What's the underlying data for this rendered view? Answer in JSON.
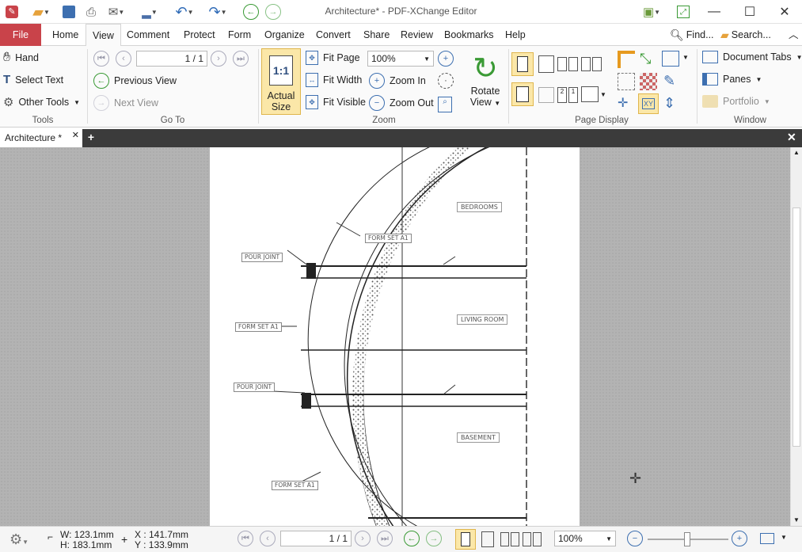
{
  "window": {
    "title": "Architecture* - PDF-XChange Editor"
  },
  "menu": {
    "file": "File",
    "home": "Home",
    "view": "View",
    "comment": "Comment",
    "protect": "Protect",
    "form": "Form",
    "organize": "Organize",
    "convert": "Convert",
    "share": "Share",
    "review": "Review",
    "bookmarks": "Bookmarks",
    "help": "Help",
    "find": "Find...",
    "search": "Search..."
  },
  "tools": {
    "hand": "Hand",
    "select_text": "Select Text",
    "other_tools": "Other Tools",
    "group": "Tools"
  },
  "goto": {
    "page_value": "1 / 1",
    "previous_view": "Previous View",
    "next_view": "Next View",
    "group": "Go To"
  },
  "zoom": {
    "actual_size_1": "Actual",
    "actual_size_2": "Size",
    "actual_icon": "1:1",
    "fit_page": "Fit Page",
    "fit_width": "Fit Width",
    "fit_visible": "Fit Visible",
    "zoom_value": "100%",
    "zoom_in": "Zoom In",
    "zoom_out": "Zoom Out",
    "rotate_1": "Rotate",
    "rotate_2": "View",
    "group": "Zoom"
  },
  "page_display": {
    "group": "Page Display"
  },
  "window_group": {
    "document_tabs": "Document Tabs",
    "panes": "Panes",
    "portfolio": "Portfolio",
    "group": "Window"
  },
  "doc_tab": {
    "label": "Architecture *"
  },
  "drawing": {
    "bedrooms": "BEDROOMS",
    "living_room": "LIVING ROOM",
    "basement": "BASEMENT",
    "form_set_a1": "FORM SET A1",
    "pour_joint": "POUR JOINT"
  },
  "status": {
    "w": "W: 123.1mm",
    "h": "H: 183.1mm",
    "x": "X : 141.7mm",
    "y": "Y : 133.9mm",
    "page_value": "1 / 1",
    "zoom_value": "100%"
  },
  "colors": {
    "file_tab": "#c9434a",
    "accent_green": "#3a9a35",
    "tabbar": "#3b3b3b"
  }
}
